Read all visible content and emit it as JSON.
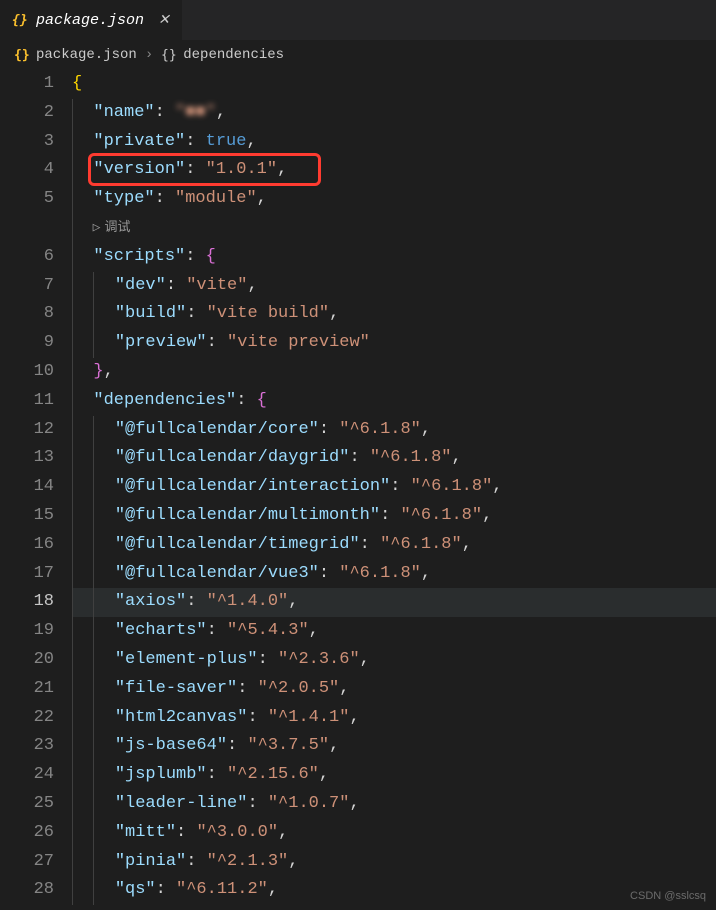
{
  "tab": {
    "filename": "package.json"
  },
  "breadcrumb": {
    "file": "package.json",
    "section": "dependencies"
  },
  "codelens": {
    "debug": "调试"
  },
  "watermark": "CSDN @sslcsq",
  "json": {
    "name_key": "\"name\"",
    "name_val": "\"■■\"",
    "private_key": "\"private\"",
    "private_val": "true",
    "version_key": "\"version\"",
    "version_val": "\"1.0.1\"",
    "type_key": "\"type\"",
    "type_val": "\"module\"",
    "scripts_key": "\"scripts\"",
    "dev_key": "\"dev\"",
    "dev_val": "\"vite\"",
    "build_key": "\"build\"",
    "build_val": "\"vite build\"",
    "preview_key": "\"preview\"",
    "preview_val": "\"vite preview\"",
    "deps_key": "\"dependencies\"",
    "d1k": "\"@fullcalendar/core\"",
    "d1v": "\"^6.1.8\"",
    "d2k": "\"@fullcalendar/daygrid\"",
    "d2v": "\"^6.1.8\"",
    "d3k": "\"@fullcalendar/interaction\"",
    "d3v": "\"^6.1.8\"",
    "d4k": "\"@fullcalendar/multimonth\"",
    "d4v": "\"^6.1.8\"",
    "d5k": "\"@fullcalendar/timegrid\"",
    "d5v": "\"^6.1.8\"",
    "d6k": "\"@fullcalendar/vue3\"",
    "d6v": "\"^6.1.8\"",
    "d7k": "\"axios\"",
    "d7v": "\"^1.4.0\"",
    "d8k": "\"echarts\"",
    "d8v": "\"^5.4.3\"",
    "d9k": "\"element-plus\"",
    "d9v": "\"^2.3.6\"",
    "d10k": "\"file-saver\"",
    "d10v": "\"^2.0.5\"",
    "d11k": "\"html2canvas\"",
    "d11v": "\"^1.4.1\"",
    "d12k": "\"js-base64\"",
    "d12v": "\"^3.7.5\"",
    "d13k": "\"jsplumb\"",
    "d13v": "\"^2.15.6\"",
    "d14k": "\"leader-line\"",
    "d14v": "\"^1.0.7\"",
    "d15k": "\"mitt\"",
    "d15v": "\"^3.0.0\"",
    "d16k": "\"pinia\"",
    "d16v": "\"^2.1.3\"",
    "d17k": "\"qs\"",
    "d17v": "\"^6.11.2\""
  },
  "line_numbers": [
    "1",
    "2",
    "3",
    "4",
    "5",
    "",
    "6",
    "7",
    "8",
    "9",
    "10",
    "11",
    "12",
    "13",
    "14",
    "15",
    "16",
    "17",
    "18",
    "19",
    "20",
    "21",
    "22",
    "23",
    "24",
    "25",
    "26",
    "27",
    "28"
  ]
}
